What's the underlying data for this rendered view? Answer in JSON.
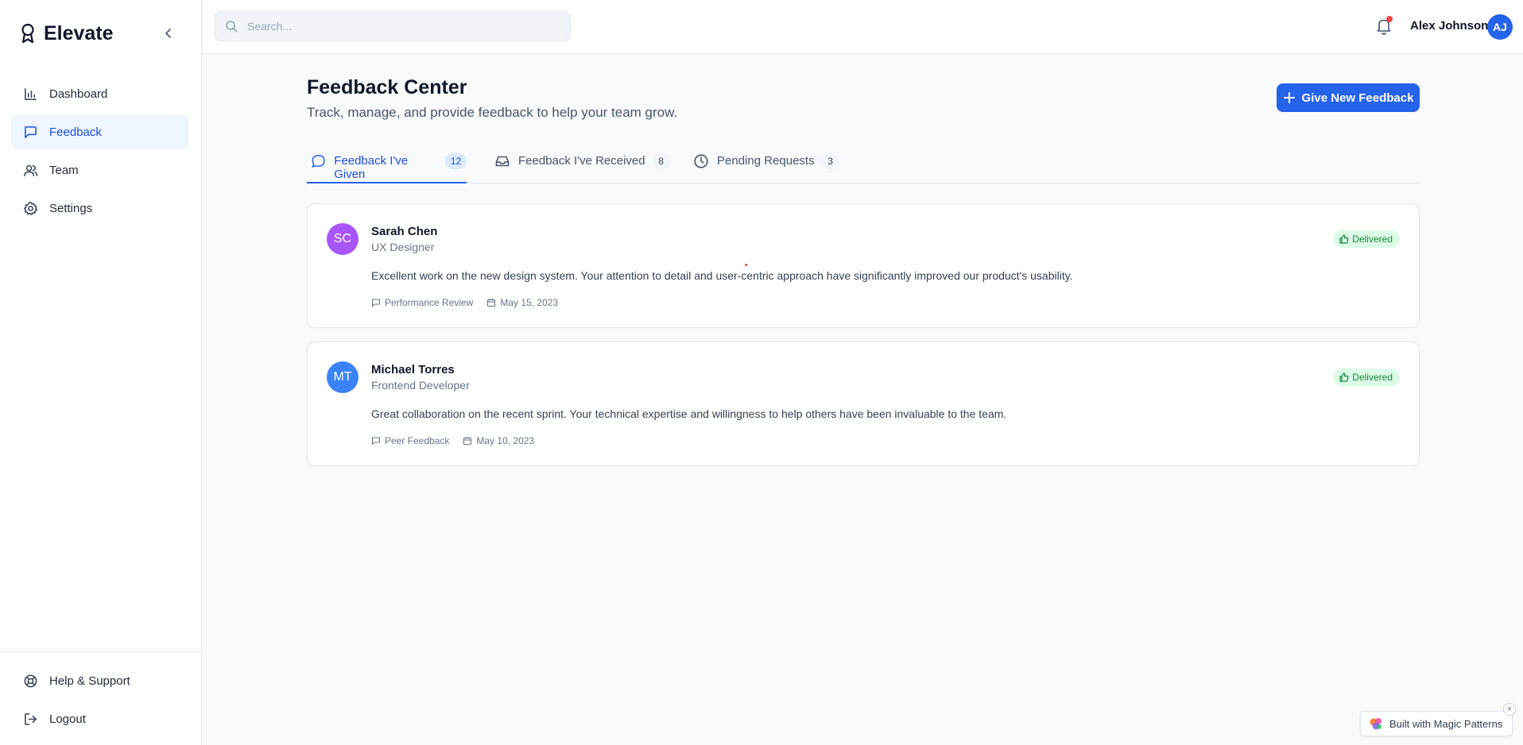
{
  "app": {
    "name": "Elevate"
  },
  "sidebar": {
    "items": [
      {
        "label": "Dashboard",
        "icon": "bar-chart-icon"
      },
      {
        "label": "Feedback",
        "icon": "message-square-icon",
        "active": true
      },
      {
        "label": "Team",
        "icon": "users-icon"
      },
      {
        "label": "Settings",
        "icon": "gear-icon"
      }
    ],
    "bottom_items": [
      {
        "label": "Help & Support",
        "icon": "life-buoy-icon"
      },
      {
        "label": "Logout",
        "icon": "logout-icon"
      }
    ]
  },
  "header": {
    "search_placeholder": "Search...",
    "user_name": "Alex Johnson",
    "user_initials": "AJ"
  },
  "page": {
    "title": "Feedback Center",
    "subtitle": "Track, manage, and provide feedback to help your team grow.",
    "primary_action": "Give New Feedback"
  },
  "tabs": [
    {
      "label": "Feedback I've Given",
      "count": "12",
      "icon": "message-circle-icon",
      "active": true
    },
    {
      "label": "Feedback I've Received",
      "count": "8",
      "icon": "inbox-icon"
    },
    {
      "label": "Pending Requests",
      "count": "3",
      "icon": "clock-icon"
    }
  ],
  "feedback": [
    {
      "initials": "SC",
      "avatar_color": "#a855f7",
      "name": "Sarah Chen",
      "role": "UX Designer",
      "status": "Delivered",
      "message": "Excellent work on the new design system. Your attention to detail and user-centric approach have significantly improved our product's usability.",
      "type": "Performance Review",
      "date": "May 15, 2023"
    },
    {
      "initials": "MT",
      "avatar_color": "#3b82f6",
      "name": "Michael Torres",
      "role": "Frontend Developer",
      "status": "Delivered",
      "message": "Great collaboration on the recent sprint. Your technical expertise and willingness to help others have been invaluable to the team.",
      "type": "Peer Feedback",
      "date": "May 10, 2023"
    }
  ],
  "footer_badge": {
    "label": "Built with Magic Patterns",
    "close": "×"
  },
  "colors": {
    "accent": "#2563eb",
    "success_bg": "#dcfce7",
    "success_text": "#15803d",
    "notification": "#ef4444"
  }
}
